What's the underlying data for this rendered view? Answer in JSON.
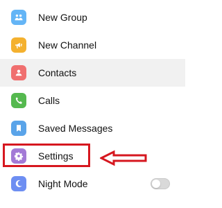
{
  "menu": {
    "items": [
      {
        "label": "New Group",
        "icon": "group-icon",
        "color": "#64b5f6"
      },
      {
        "label": "New Channel",
        "icon": "megaphone-icon",
        "color": "#f4b12f"
      },
      {
        "label": "Contacts",
        "icon": "contact-icon",
        "color": "#f06f6f"
      },
      {
        "label": "Calls",
        "icon": "phone-icon",
        "color": "#55b94f"
      },
      {
        "label": "Saved Messages",
        "icon": "bookmark-icon",
        "color": "#5aa4e9"
      },
      {
        "label": "Settings",
        "icon": "gear-icon",
        "color": "#a37ad6"
      },
      {
        "label": "Night Mode",
        "icon": "moon-icon",
        "color": "#6d8ef2",
        "toggle_state": "off"
      }
    ],
    "active_item": "Contacts"
  },
  "annotation": {
    "target": "Settings",
    "color": "#d6171f"
  }
}
